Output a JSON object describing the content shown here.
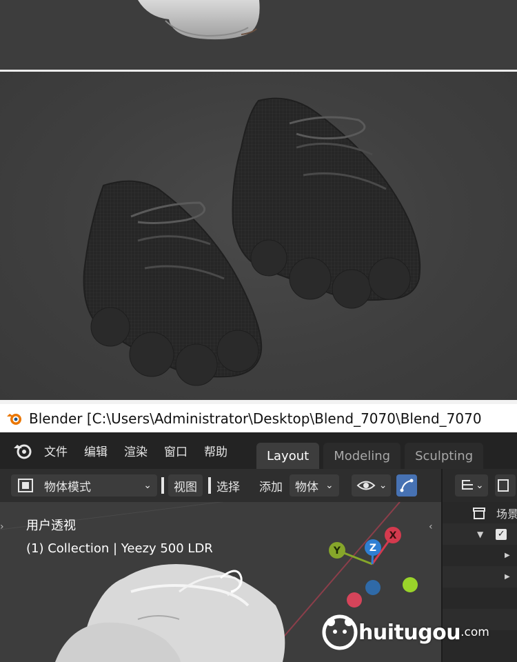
{
  "window": {
    "title": "Blender [C:\\Users\\Administrator\\Desktop\\Blend_7070\\Blend_7070"
  },
  "menu": {
    "items": [
      "文件",
      "编辑",
      "渲染",
      "窗口",
      "帮助"
    ]
  },
  "workspaces": {
    "tabs": [
      "Layout",
      "Modeling",
      "Sculpting"
    ],
    "active": "Layout"
  },
  "viewport_header": {
    "mode": "物体模式",
    "view": "视图",
    "select": "选择",
    "add": "添加",
    "object": "物体"
  },
  "outliner": {
    "scene_label": "场景"
  },
  "viewport": {
    "perspective_label": "用户透视",
    "collection_label": "(1) Collection | Yeezy 500 LDR",
    "gizmo_axes": {
      "x": "X",
      "y": "Y",
      "z": "Z"
    }
  },
  "watermark": {
    "brand": "huitugou",
    "domain": ".com"
  },
  "colors": {
    "axis_x": "#d43a4e",
    "axis_y": "#86a62a",
    "axis_z": "#2f7fd3",
    "header_bg": "#2e2e2e",
    "topbar_bg": "#232323",
    "active_tab_bg": "#3d3d3d",
    "active_tool": "#4772b3"
  }
}
